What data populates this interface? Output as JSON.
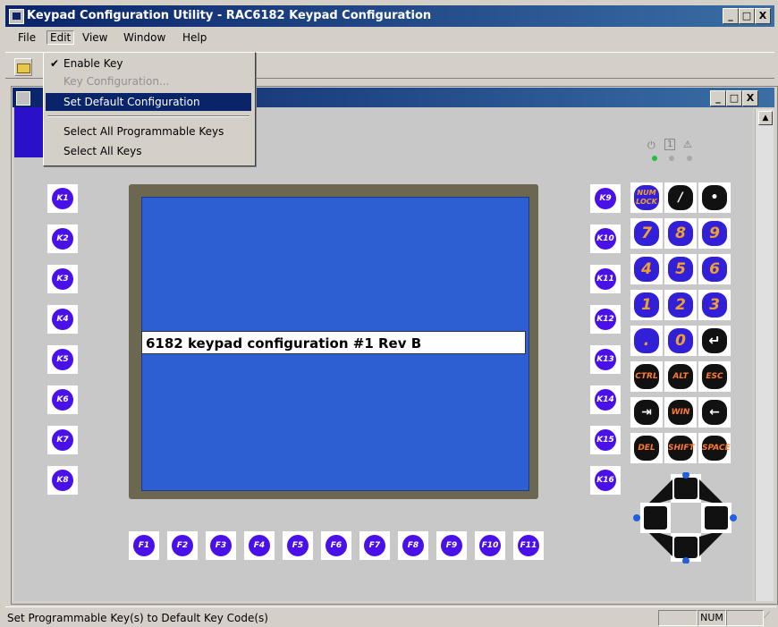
{
  "window": {
    "title": "Keypad Configuration Utility - RAC6182 Keypad Configuration",
    "controls": [
      "_",
      "□",
      "X"
    ]
  },
  "menubar": {
    "items": [
      "File",
      "Edit",
      "View",
      "Window",
      "Help"
    ]
  },
  "edit_menu": {
    "items": [
      {
        "label": "Enable Key",
        "checked": true,
        "enabled": true
      },
      {
        "label": "Key Configuration...",
        "checked": false,
        "enabled": false
      },
      {
        "label": "Set Default Configuration",
        "checked": false,
        "enabled": true,
        "highlighted": true
      },
      {
        "label": "Select All Programmable Keys",
        "checked": false,
        "enabled": true
      },
      {
        "label": "Select All Keys",
        "checked": false,
        "enabled": true
      }
    ],
    "check_glyph": "✔"
  },
  "child_window": {
    "controls": [
      "_",
      "□",
      "X"
    ]
  },
  "screen": {
    "label": "6182 keypad configuration #1 Rev B",
    "color": "#2d5fd2"
  },
  "left_keys": [
    "K1",
    "K2",
    "K3",
    "K4",
    "K5",
    "K6",
    "K7",
    "K8"
  ],
  "right_keys": [
    "K9",
    "K10",
    "K11",
    "K12",
    "K13",
    "K14",
    "K15",
    "K16"
  ],
  "function_keys": [
    "F1",
    "F2",
    "F3",
    "F4",
    "F5",
    "F6",
    "F7",
    "F8",
    "F9",
    "F10",
    "F11"
  ],
  "numpad": [
    [
      "NUM LOCK",
      "/",
      "•"
    ],
    [
      "7",
      "8",
      "9"
    ],
    [
      "4",
      "5",
      "6"
    ],
    [
      "1",
      "2",
      "3"
    ],
    [
      ".",
      "0",
      "↵"
    ],
    [
      "CTRL",
      "ALT",
      "ESC"
    ],
    [
      "⇥",
      "WIN",
      "←"
    ],
    [
      "DEL",
      "SHIFT",
      "SPACE"
    ]
  ],
  "indicators": [
    "⏻",
    "1",
    "⚠"
  ],
  "colors": {
    "key_blue": "#4a10e8",
    "accent_orange": "#f0a030",
    "title_blue": "#0a246a"
  },
  "statusbar": {
    "message": "Set Programmable Key(s) to Default Key Code(s)",
    "num": "NUM"
  }
}
